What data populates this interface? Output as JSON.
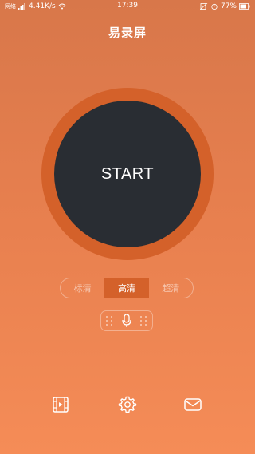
{
  "status_bar": {
    "carrier": "网络",
    "speed": "4.41K/s",
    "time": "17:39",
    "battery": "77%",
    "icons": [
      "signal-icon",
      "wifi-icon",
      "no-sim-icon",
      "alarm-icon",
      "battery-icon"
    ]
  },
  "app": {
    "title": "易录屏"
  },
  "record": {
    "start_label": "START"
  },
  "quality": {
    "options": [
      "标清",
      "高清",
      "超清"
    ],
    "selected": "高清"
  },
  "audio": {
    "icon": "microphone-icon"
  },
  "bottom_nav": {
    "icons": [
      "video-list-icon",
      "settings-gear-icon",
      "mail-icon"
    ]
  },
  "colors": {
    "background_top": "#d8774a",
    "background_bottom": "#f58c57",
    "ring": "#d4612a",
    "button": "#292d33",
    "active_tab": "#d4612a"
  }
}
